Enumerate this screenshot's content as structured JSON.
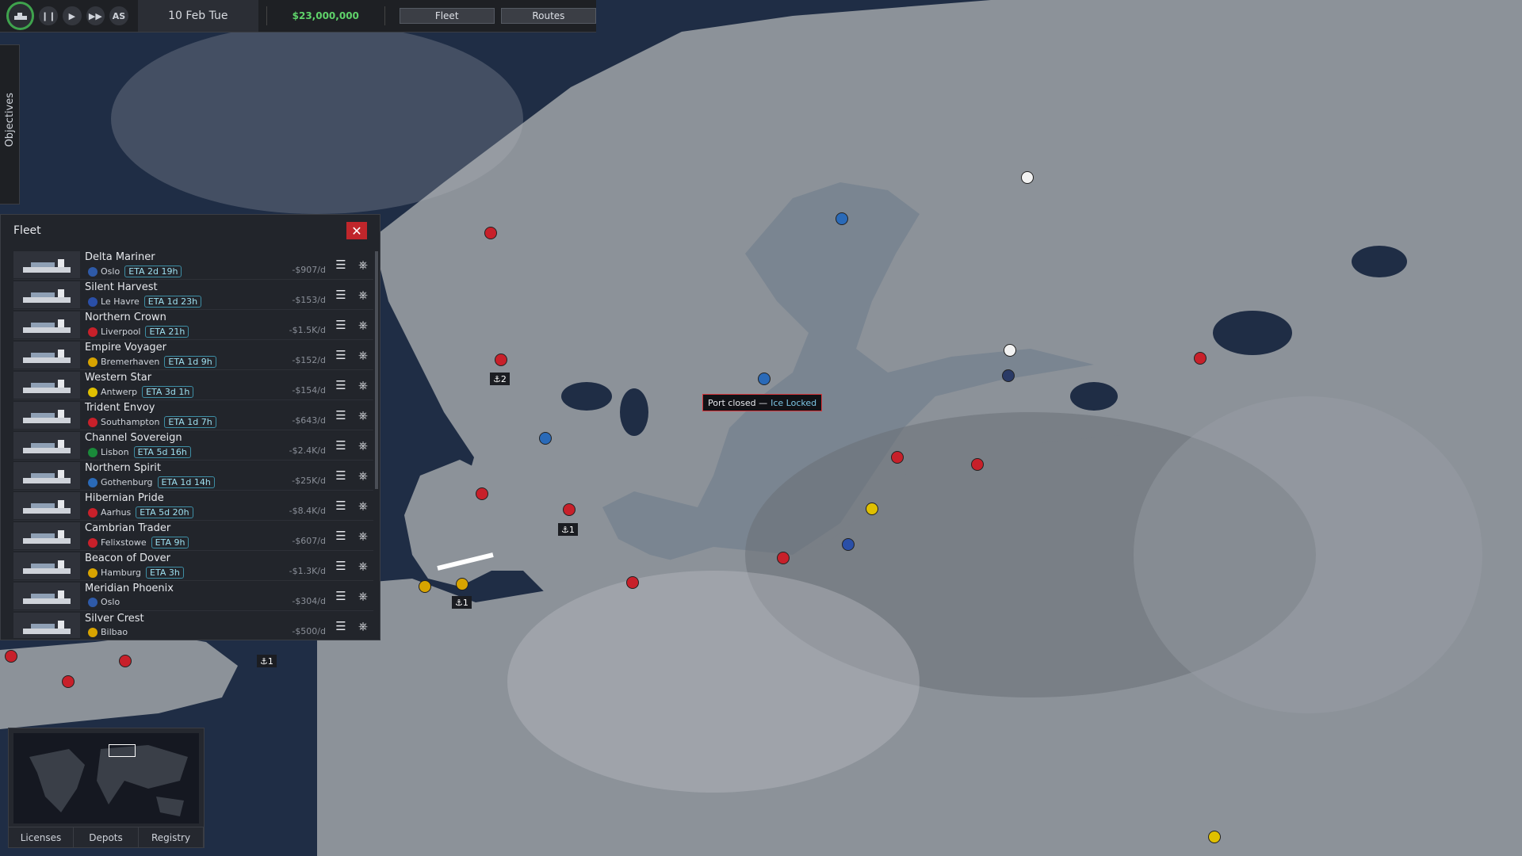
{
  "topbar": {
    "speed_buttons": [
      "pause-icon",
      "play-icon",
      "fast-forward-icon"
    ],
    "autospeed_label": "AS",
    "date": "10 Feb Tue",
    "money": "$23,000,000",
    "fleet_label": "Fleet",
    "routes_label": "Routes"
  },
  "objectives_label": "Objectives",
  "fleet": {
    "title": "Fleet",
    "close_label": "✕",
    "ships": [
      {
        "name": "Delta Mariner",
        "port": "Oslo",
        "eta": "ETA 2d 19h",
        "cost": "-$907/d",
        "flag": "#2e5aa8"
      },
      {
        "name": "Silent Harvest",
        "port": "Le Havre",
        "eta": "ETA 1d 23h",
        "cost": "-$153/d",
        "flag": "#2a4fa8"
      },
      {
        "name": "Northern Crown",
        "port": "Liverpool",
        "eta": "ETA 21h",
        "cost": "-$1.5K/d",
        "flag": "#c8202a"
      },
      {
        "name": "Empire Voyager",
        "port": "Bremerhaven",
        "eta": "ETA 1d 9h",
        "cost": "-$152/d",
        "flag": "#d8a400"
      },
      {
        "name": "Western Star",
        "port": "Antwerp",
        "eta": "ETA 3d 1h",
        "cost": "-$154/d",
        "flag": "#e0c000"
      },
      {
        "name": "Trident Envoy",
        "port": "Southampton",
        "eta": "ETA 1d 7h",
        "cost": "-$643/d",
        "flag": "#c8202a"
      },
      {
        "name": "Channel Sovereign",
        "port": "Lisbon",
        "eta": "ETA 5d 16h",
        "cost": "-$2.4K/d",
        "flag": "#1a8a3a"
      },
      {
        "name": "Northern Spirit",
        "port": "Gothenburg",
        "eta": "ETA 1d 14h",
        "cost": "-$25K/d",
        "flag": "#2a6ab8"
      },
      {
        "name": "Hibernian Pride",
        "port": "Aarhus",
        "eta": "ETA 5d 20h",
        "cost": "-$8.4K/d",
        "flag": "#c8202a"
      },
      {
        "name": "Cambrian Trader",
        "port": "Felixstowe",
        "eta": "ETA 9h",
        "cost": "-$607/d",
        "flag": "#c8202a"
      },
      {
        "name": "Beacon of Dover",
        "port": "Hamburg",
        "eta": "ETA 3h",
        "cost": "-$1.3K/d",
        "flag": "#d8a400"
      },
      {
        "name": "Meridian Phoenix",
        "port": "Oslo",
        "eta": "",
        "cost": "-$304/d",
        "flag": "#2e5aa8"
      },
      {
        "name": "Silver Crest",
        "port": "Bilbao",
        "eta": "",
        "cost": "-$500/d",
        "flag": "#d8a400"
      }
    ]
  },
  "tooltip": {
    "text": "Port closed —",
    "reason": "Ice Locked"
  },
  "anchors": [
    "⚓2",
    "⚓1",
    "⚓1",
    "⚓1"
  ],
  "minimap": {
    "licenses": "Licenses",
    "depots": "Depots",
    "registry": "Registry"
  }
}
